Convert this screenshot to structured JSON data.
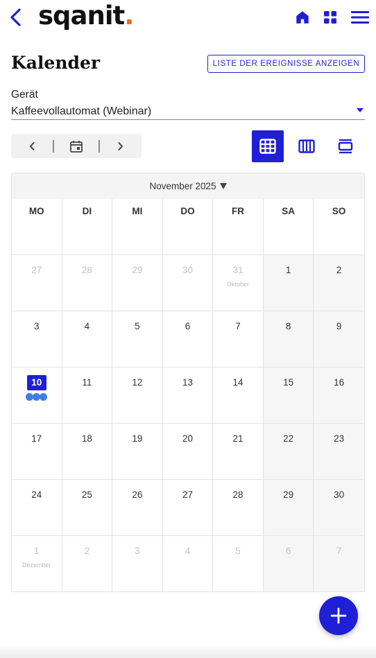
{
  "header": {
    "logo_text": "sqanit",
    "logo_dot": ".",
    "icons": [
      "back-icon",
      "home-icon",
      "grid-icon",
      "menu-icon"
    ],
    "accent_color": "#1f1fd6",
    "logo_dot_color": "#f26b1d"
  },
  "page": {
    "title": "Kalender",
    "list_button": "LISTE DER EREIGNISSE ANZEIGEN"
  },
  "device": {
    "label": "Gerät",
    "value": "Kaffeevollautomat (Webinar)"
  },
  "toolbar": {
    "icons": [
      "chevron-left-icon",
      "calendar-today-icon",
      "chevron-right-icon"
    ],
    "views": [
      "month-view-icon",
      "week-view-icon",
      "day-view-icon"
    ],
    "active_view": "month"
  },
  "calendar": {
    "month_label": "November 2025",
    "weekdays": [
      "MO",
      "DI",
      "MI",
      "DO",
      "FR",
      "SA",
      "SO"
    ],
    "weeks": [
      [
        {
          "d": "27",
          "muted": true
        },
        {
          "d": "28",
          "muted": true
        },
        {
          "d": "29",
          "muted": true
        },
        {
          "d": "30",
          "muted": true
        },
        {
          "d": "31",
          "muted": true,
          "sub": "Oktober"
        },
        {
          "d": "1"
        },
        {
          "d": "2"
        }
      ],
      [
        {
          "d": "3"
        },
        {
          "d": "4"
        },
        {
          "d": "5"
        },
        {
          "d": "6"
        },
        {
          "d": "7"
        },
        {
          "d": "8"
        },
        {
          "d": "9"
        }
      ],
      [
        {
          "d": "10",
          "today": true,
          "events": 3
        },
        {
          "d": "11"
        },
        {
          "d": "12"
        },
        {
          "d": "13"
        },
        {
          "d": "14"
        },
        {
          "d": "15"
        },
        {
          "d": "16"
        }
      ],
      [
        {
          "d": "17"
        },
        {
          "d": "18"
        },
        {
          "d": "19"
        },
        {
          "d": "20"
        },
        {
          "d": "21"
        },
        {
          "d": "22"
        },
        {
          "d": "23"
        }
      ],
      [
        {
          "d": "24"
        },
        {
          "d": "25"
        },
        {
          "d": "26"
        },
        {
          "d": "27"
        },
        {
          "d": "28"
        },
        {
          "d": "29"
        },
        {
          "d": "30"
        }
      ],
      [
        {
          "d": "1",
          "muted": true,
          "sub": "Dezember"
        },
        {
          "d": "2",
          "muted": true
        },
        {
          "d": "3",
          "muted": true
        },
        {
          "d": "4",
          "muted": true
        },
        {
          "d": "5",
          "muted": true
        },
        {
          "d": "6",
          "muted": true
        },
        {
          "d": "7",
          "muted": true
        }
      ]
    ],
    "event_color": "#3f7de0"
  },
  "fab": {
    "icon": "plus-icon"
  }
}
